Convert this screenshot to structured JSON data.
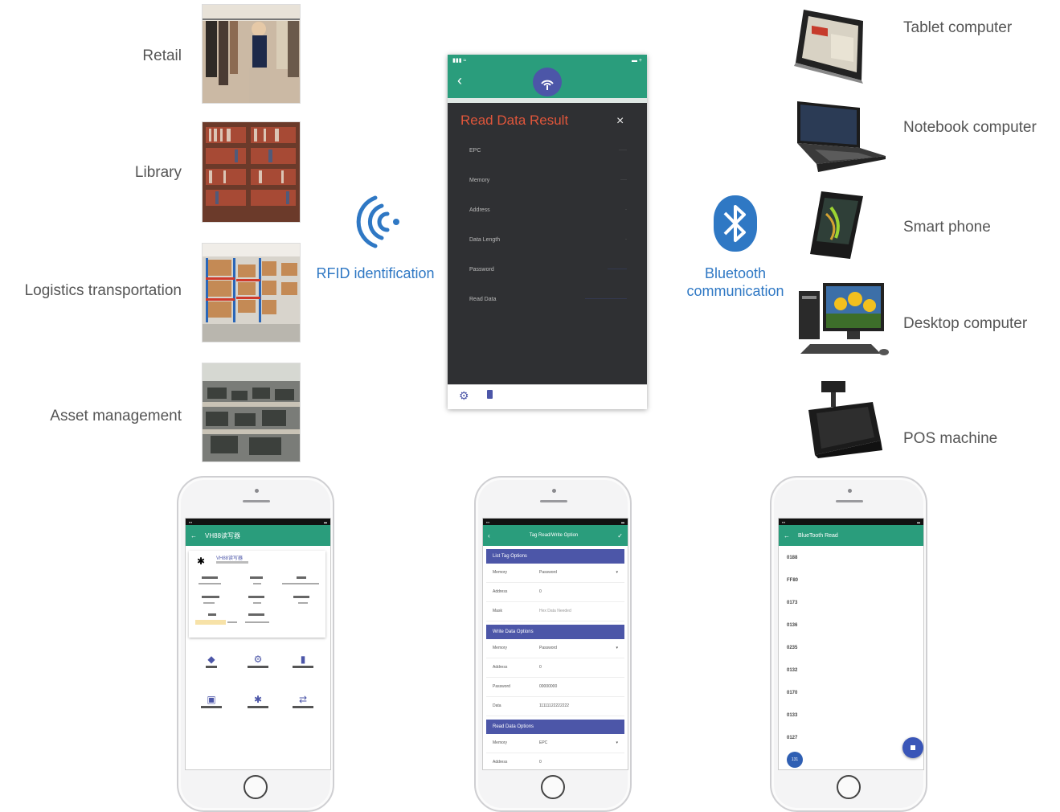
{
  "left_applications": [
    {
      "label": "Retail"
    },
    {
      "label": "Library"
    },
    {
      "label": "Logistics transportation"
    },
    {
      "label": "Asset management"
    }
  ],
  "rfid": {
    "label": "RFID identification",
    "icon": "rfid-waves-icon",
    "color": "#2f78c4"
  },
  "bluetooth": {
    "line1": "Bluetooth",
    "line2": "communication",
    "icon": "bluetooth-icon",
    "color": "#2f78c4"
  },
  "right_devices": [
    {
      "label": "Tablet computer"
    },
    {
      "label": "Notebook computer"
    },
    {
      "label": "Smart phone"
    },
    {
      "label": "Desktop computer"
    },
    {
      "label": "POS machine"
    }
  ],
  "center_screen": {
    "dialog_title": "Read Data Result",
    "close_glyph": "×",
    "accent": "#2a9d7c",
    "title_color": "#e0563b",
    "rows": [
      {
        "label": "EPC"
      },
      {
        "label": "Memory"
      },
      {
        "label": "Address"
      },
      {
        "label": "Data Length"
      },
      {
        "label": "Password"
      },
      {
        "label": "Read Data"
      }
    ]
  },
  "phone_left": {
    "title": "VH88读写器",
    "device_name": "VH88读写器"
  },
  "phone_middle": {
    "title": "Tag Read/Write Option",
    "sections": [
      {
        "header": "List Tag Options",
        "rows": [
          {
            "label": "Memory",
            "value": "Password"
          },
          {
            "label": "Address",
            "value": "0"
          },
          {
            "label": "Mask",
            "value": "Hex Data Needed"
          }
        ]
      },
      {
        "header": "Write Data Options",
        "rows": [
          {
            "label": "Memory",
            "value": "Password"
          },
          {
            "label": "Address",
            "value": "0"
          },
          {
            "label": "Password",
            "value": "00000000"
          },
          {
            "label": "Data",
            "value": "11111122222222"
          }
        ]
      },
      {
        "header": "Read Data Options",
        "rows": [
          {
            "label": "Memory",
            "value": "EPC"
          },
          {
            "label": "Address",
            "value": "0"
          }
        ]
      }
    ]
  },
  "phone_right": {
    "title": "BlueTooth Read",
    "items": [
      "0188",
      "FF80",
      "0173",
      "0136",
      "0235",
      "0132",
      "0170",
      "0133",
      "0127"
    ],
    "count_badge": "131"
  }
}
